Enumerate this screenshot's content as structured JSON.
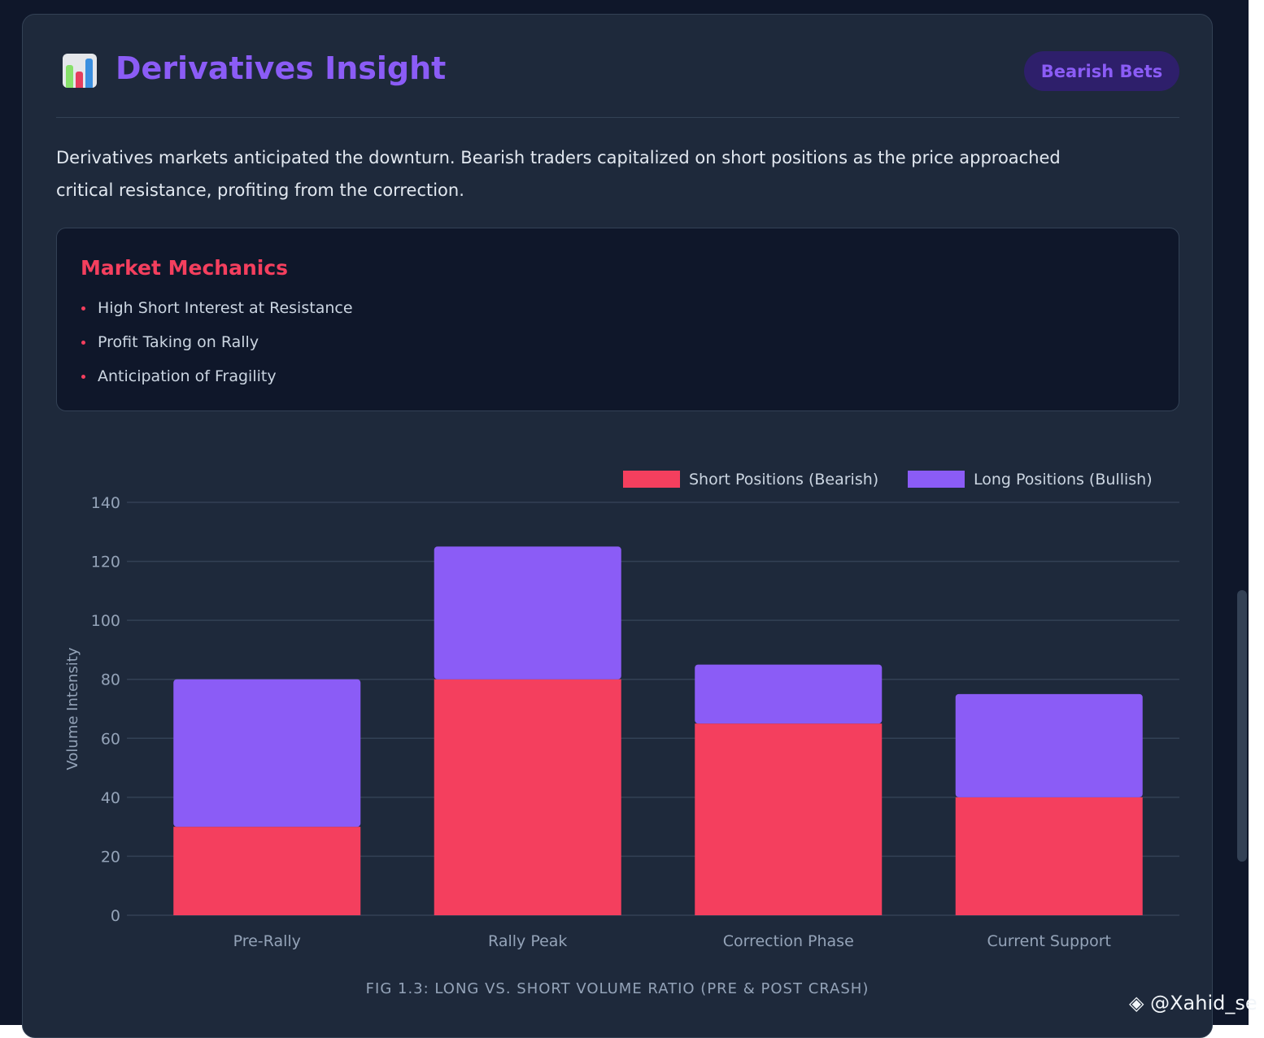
{
  "header": {
    "title": "Derivatives Insight",
    "icon": "bar-chart-icon",
    "badge": "Bearish Bets"
  },
  "description": "Derivatives markets anticipated the downturn. Bearish traders capitalized on short positions as the price approached critical resistance, profiting from the correction.",
  "mechanics": {
    "title": "Market Mechanics",
    "items": [
      "High Short Interest at Resistance",
      "Profit Taking on Rally",
      "Anticipation of Fragility"
    ]
  },
  "chart_data": {
    "type": "bar",
    "stacked": true,
    "categories": [
      "Pre-Rally",
      "Rally Peak",
      "Correction Phase",
      "Current Support"
    ],
    "series": [
      {
        "name": "Short Positions (Bearish)",
        "color": "#f43f5e",
        "values": [
          30,
          80,
          65,
          40
        ]
      },
      {
        "name": "Long Positions (Bullish)",
        "color": "#8b5cf6",
        "values": [
          50,
          45,
          20,
          35
        ]
      }
    ],
    "ylabel": "Volume Intensity",
    "ylim": [
      0,
      140
    ],
    "yticks": [
      0,
      20,
      40,
      60,
      80,
      100,
      120,
      140
    ],
    "grid": true,
    "legend": "top-right"
  },
  "caption": "FIG 1.3: LONG VS. SHORT VOLUME RATIO (PRE & POST CRASH)",
  "watermark": "@Xahid_se"
}
